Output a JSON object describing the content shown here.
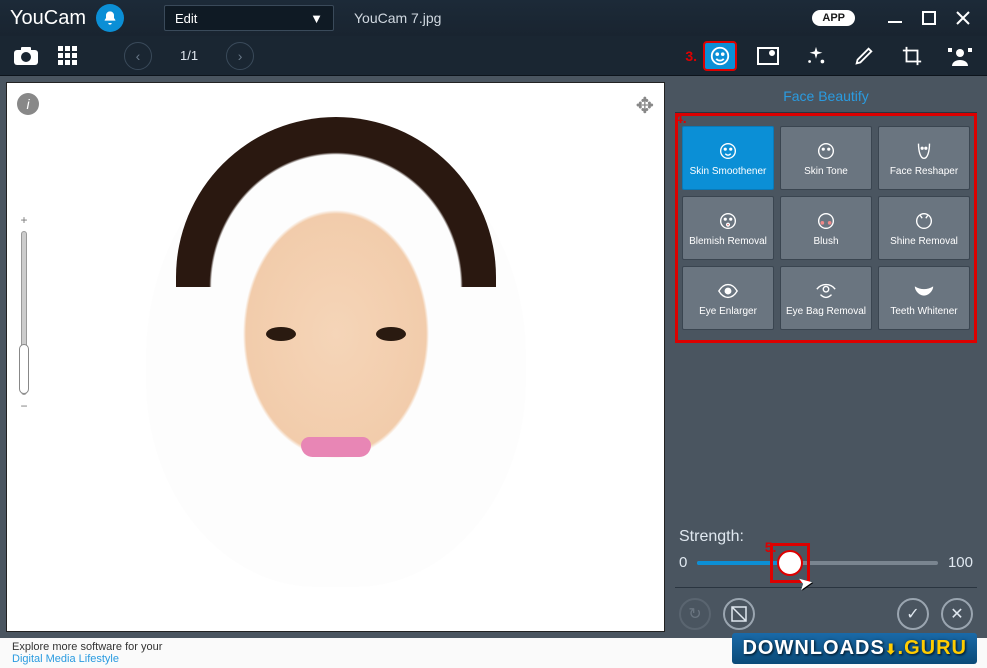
{
  "titlebar": {
    "app_name": "YouCam",
    "mode": "Edit",
    "filename": "YouCam 7.jpg",
    "app_badge": "APP"
  },
  "toolbar": {
    "page_count": "1/1",
    "annotation_3": "3."
  },
  "panel": {
    "title": "Face Beautify",
    "annotation_4": "4.",
    "tools": [
      {
        "label": "Skin Smoothener",
        "active": true
      },
      {
        "label": "Skin Tone",
        "active": false
      },
      {
        "label": "Face Reshaper",
        "active": false
      },
      {
        "label": "Blemish Removal",
        "active": false
      },
      {
        "label": "Blush",
        "active": false
      },
      {
        "label": "Shine Removal",
        "active": false
      },
      {
        "label": "Eye Enlarger",
        "active": false
      },
      {
        "label": "Eye Bag Removal",
        "active": false
      },
      {
        "label": "Teeth Whitener",
        "active": false
      }
    ],
    "strength_label": "Strength:",
    "slider": {
      "min": "0",
      "max": "100",
      "value": 35
    },
    "annotation_5": "5."
  },
  "footer": {
    "line1": "Explore more software for your",
    "line2": "Digital Media Lifestyle",
    "watermark_a": "DOWNLOADS",
    "watermark_b": ".GURU"
  }
}
